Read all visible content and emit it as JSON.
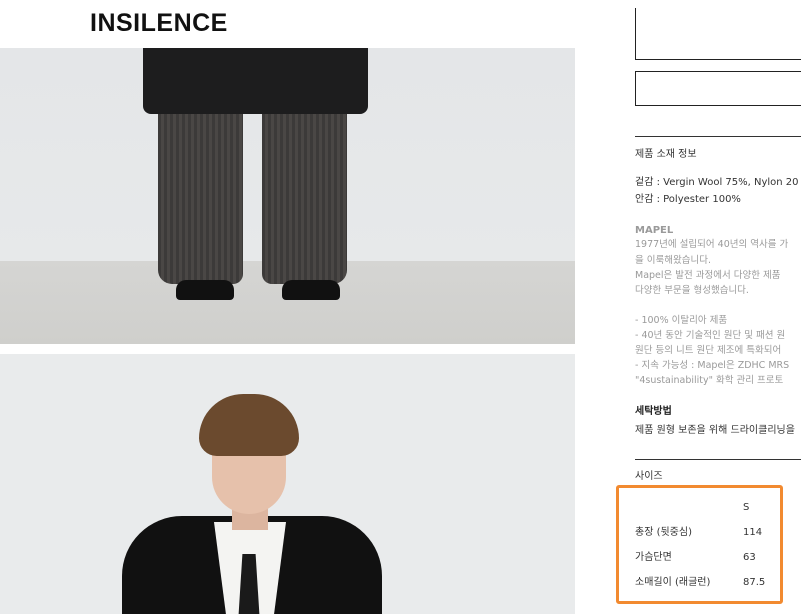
{
  "brand": {
    "logo_text": "INSILENCE"
  },
  "product_info": {
    "material_heading": "제품 소재 정보",
    "outer_material": "겉감 : Vergin Wool 75%, Nylon 20",
    "lining_material": "안감 : Polyester 100%",
    "maker_name": "MAPEL",
    "maker_description": [
      "1977년에 설립되어 40년의 역사를 가",
      "을 이룩해왔습니다.",
      "Mapel은 발전 과정에서 다양한 제품",
      "다양한 부문을 형성했습니다."
    ],
    "maker_points": [
      "- 100% 이탈리아 제품",
      "- 40년 동안 기술적인 원단 및 패션 원",
      "원단 등의 니트 원단 제조에 특화되어",
      "- 지속 가능성 : Mapel은 ZDHC MRS",
      "\"4sustainability\" 화학 관리 프로토"
    ],
    "care_heading": "세탁방법",
    "care_text": "제품 원형 보존을 위해 드라이클리닝을",
    "size_heading": "사이즈"
  },
  "size_chart": {
    "size_label": "S",
    "rows": [
      {
        "name": "총장 (뒷중심)",
        "value": "114"
      },
      {
        "name": "가슴단면",
        "value": "63"
      },
      {
        "name": "소매길이 (래글런)",
        "value": "87.5"
      }
    ]
  },
  "colors": {
    "highlight": "#f28a30",
    "text": "#333333",
    "muted_text": "#9a9a9a"
  }
}
